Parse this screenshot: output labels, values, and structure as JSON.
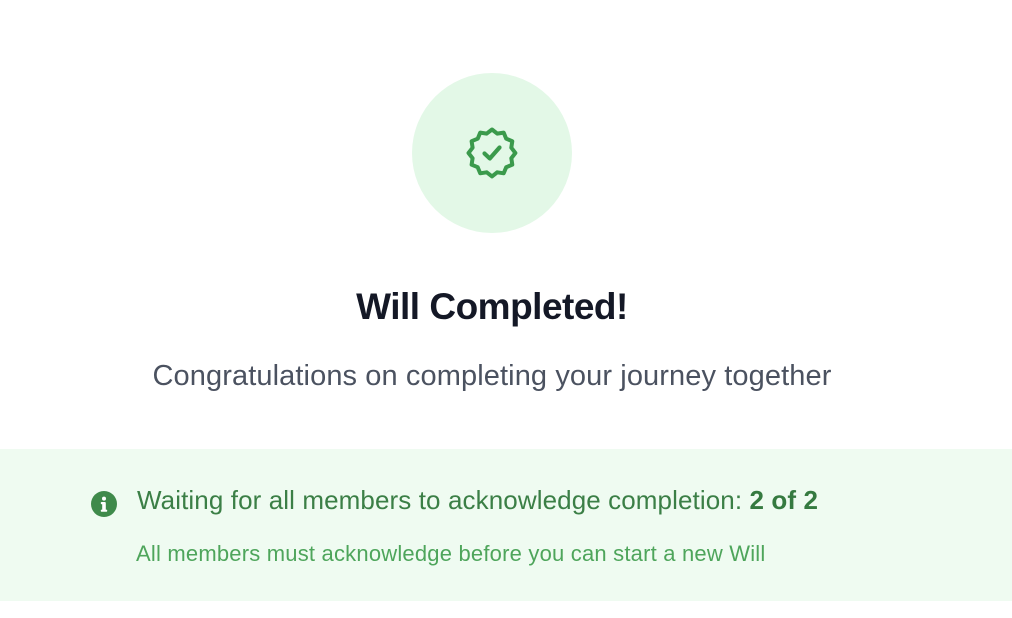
{
  "completion": {
    "icon": "badge-check-icon",
    "title": "Will Completed!",
    "subtitle": "Congratulations on completing your journey together"
  },
  "acknowledgement": {
    "icon": "info-icon",
    "message": "Waiting for all members to acknowledge completion:",
    "count": "2 of 2",
    "note": "All members must acknowledge before you can start a new Will"
  },
  "colors": {
    "accent_green": "#3b9a4c",
    "badge_background": "#e3f8e7",
    "notice_background": "#effbf1",
    "title_text": "#141826"
  }
}
